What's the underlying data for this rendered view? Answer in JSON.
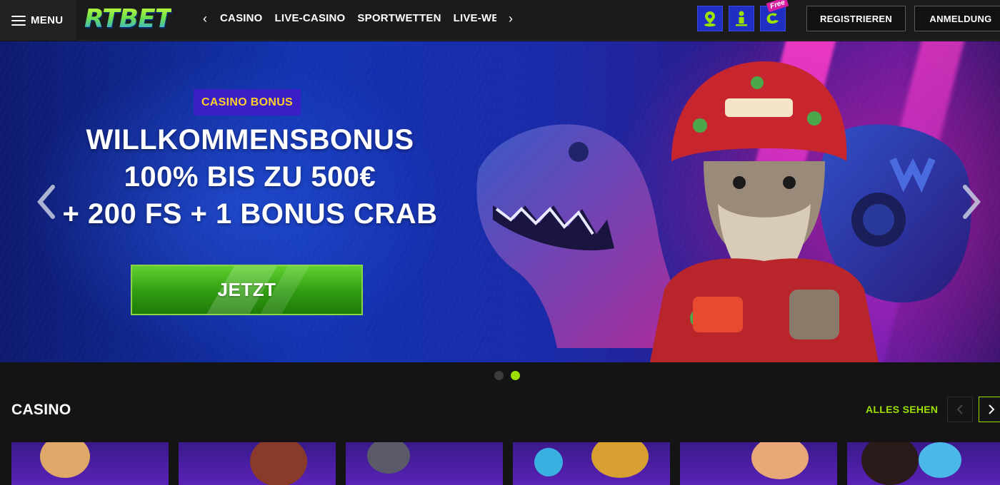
{
  "header": {
    "menu_label": "MENU",
    "logo_text": "RTBET",
    "nav_items": [
      "CASINO",
      "LIVE-CASINO",
      "SPORTWETTEN",
      "LIVE-WETTEN"
    ],
    "free_label": "Free",
    "register_label": "REGISTRIEREN",
    "login_label": "ANMELDUNG",
    "icons": [
      "map-pin-icon",
      "person-info-icon",
      "free-spin-icon"
    ],
    "icon_accent": "#1f2fc4",
    "icon_fg": "#9be000"
  },
  "hero": {
    "tag": "CASINO BONUS",
    "title_line1": "WILLKOMMENSBONUS",
    "title_line2": "100% BIS ZU 500€",
    "title_line3": "+ 200 FS + 1 BONUS CRAB",
    "cta_label": "JETZT",
    "slide_count": 2,
    "active_slide": 2
  },
  "casino_section": {
    "title": "CASINO",
    "see_all_label": "ALLES SEHEN"
  },
  "colors": {
    "brand_green": "#9be000",
    "header_bg": "#1b1b1b",
    "page_bg": "#141414",
    "tag_bg": "#3a1fc6",
    "tag_text": "#ffcf2a"
  }
}
